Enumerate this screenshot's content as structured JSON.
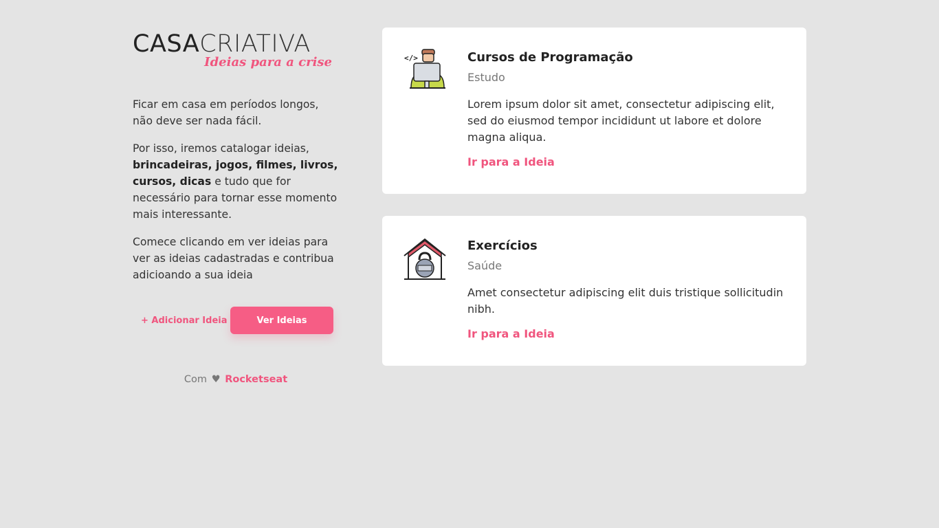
{
  "logo": {
    "part1": "CASA",
    "part2": "CRIATIVA",
    "tagline": "Ideias para a crise"
  },
  "intro": {
    "p1": "Ficar em casa em períodos longos, não deve ser nada fácil.",
    "p2_start": "Por isso, iremos catalogar ideias, ",
    "p2_bold": "brincadeiras, jogos, filmes, livros, cursos, dicas",
    "p2_end": " e tudo que for necessário para tornar esse momento mais interessante.",
    "p3": "Comece clicando em ver ideias para ver as ideias cadastradas e contribua adicioando a sua ideia"
  },
  "actions": {
    "add_label": "+ Adicionar Ideia",
    "view_label": "Ver Ideias"
  },
  "credit": {
    "prefix": "Com",
    "heart": "♥",
    "brand": "Rocketseat"
  },
  "ideas": [
    {
      "icon": "programmer-icon",
      "title": "Cursos de Programação",
      "category": "Estudo",
      "description": "Lorem ipsum dolor sit amet, consectetur adipiscing elit, sed do eiusmod tempor incididunt ut labore et dolore magna aliqua.",
      "link_label": "Ir para a Ideia"
    },
    {
      "icon": "home-gym-icon",
      "title": "Exercícios",
      "category": "Saúde",
      "description": "Amet consectetur adipiscing elit duis tristique sollicitudin nibh.",
      "link_label": "Ir para a Ideia"
    }
  ],
  "colors": {
    "accent": "#f65d85",
    "background": "#e4e4e4"
  }
}
